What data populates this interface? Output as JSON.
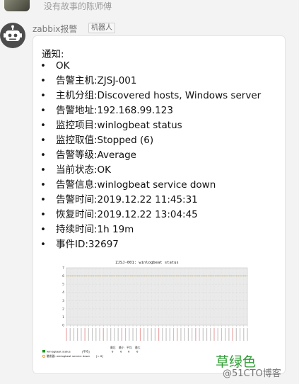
{
  "previous_message": {
    "sender_name": "没有故事的陈师傅"
  },
  "message": {
    "sender": "zabbix报警",
    "badge": "机器人",
    "notice_title": "通知:",
    "items": [
      "OK",
      "告警主机:ZJSJ-001",
      "主机分组:Discovered hosts, Windows server",
      "告警地址:192.168.99.123",
      "监控项目:winlogbeat status",
      "监控取值:Stopped (6)",
      "告警等级:Average",
      "当前状态:OK",
      "告警信息:winlogbeat service down",
      "告警时间:2019.12.22 11:45:31",
      "恢复时间:2019.12.22 13:04:45",
      "持续时间:1h 19m",
      "事件ID:32697"
    ]
  },
  "chart_data": {
    "type": "line",
    "title": "ZJSJ-001: winlogbeat status",
    "ylim": [
      0,
      7
    ],
    "yticks": [
      "0",
      "1",
      "2",
      "3",
      "4",
      "5",
      "6",
      "7"
    ],
    "x_count": 50,
    "series": [
      {
        "name": "winlogbeat status",
        "color": "#1a9a1a",
        "value": 6
      },
      {
        "name": "触发器: winlogbeat service down",
        "color": "#e08000",
        "value": 6
      }
    ],
    "legend_columns": [
      "最后",
      "最小",
      "平均",
      "最大"
    ],
    "legend_rows": [
      {
        "label": "winlogbeat status",
        "agg": "[平均]",
        "values": [
          "6",
          "6",
          "6",
          "6"
        ]
      },
      {
        "label": "触发器: winlogbeat service down",
        "agg": "[= 6]",
        "values": []
      }
    ],
    "grid": true
  },
  "watermarks": {
    "green_text": "草绿色",
    "blog_text": "@51CTO博客"
  },
  "colors": {
    "bubble": "#ffffff",
    "avatar": "#4c4c4c",
    "series_line": "#e08000",
    "watermark_green": "#2e9d32"
  },
  "icons": {
    "bot": "robot-icon"
  }
}
